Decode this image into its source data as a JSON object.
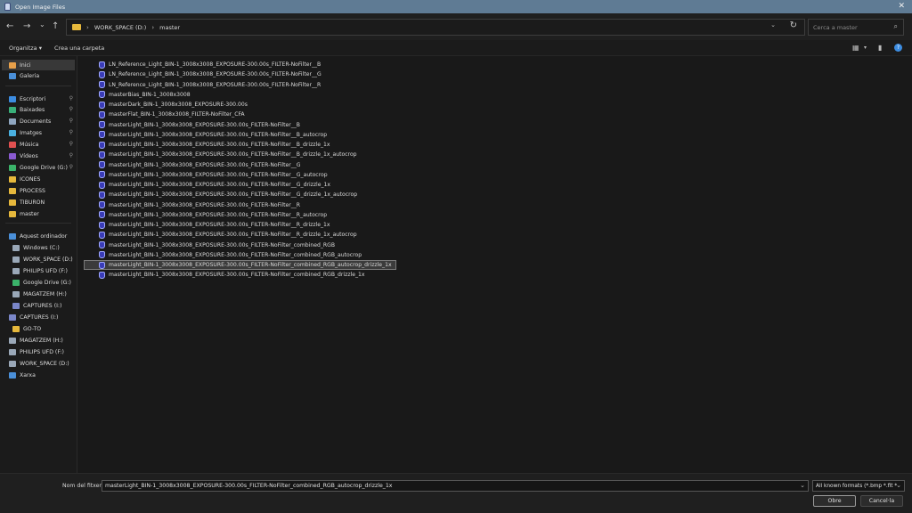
{
  "window": {
    "title": "Open Image Files"
  },
  "nav": {
    "back": "←",
    "forward": "→",
    "recent": "⌄",
    "up": "↑"
  },
  "address": {
    "root_sep": "›",
    "drive": "WORK_SPACE (D:)",
    "folder": "master"
  },
  "search": {
    "placeholder": "Cerca a master"
  },
  "toolbar": {
    "organize": "Organitza ▾",
    "new_folder": "Crea una carpeta"
  },
  "sidebar": {
    "items": [
      {
        "label": "Inici",
        "icon": "home-icon",
        "color": "#e8a04a"
      },
      {
        "label": "Galeria",
        "icon": "gallery-icon",
        "color": "#4a8fd8"
      },
      {
        "label": "Escriptori",
        "icon": "desktop-icon",
        "color": "#3c8ce0"
      },
      {
        "label": "Baixades",
        "icon": "download-icon",
        "color": "#39b07a"
      },
      {
        "label": "Documents",
        "icon": "documents-icon",
        "color": "#8fa6c0"
      },
      {
        "label": "Imatges",
        "icon": "pictures-icon",
        "color": "#4ab0e0"
      },
      {
        "label": "Música",
        "icon": "music-icon",
        "color": "#e05050"
      },
      {
        "label": "Vídeos",
        "icon": "videos-icon",
        "color": "#8a5ad0"
      },
      {
        "label": "Google Drive (G:)",
        "icon": "google-drive-icon",
        "color": "#3bb36a"
      },
      {
        "label": "ICONES",
        "icon": "folder-icon",
        "color": "#e6b83c"
      },
      {
        "label": "PROCESS",
        "icon": "folder-icon",
        "color": "#e6b83c"
      },
      {
        "label": "TIBURON",
        "icon": "folder-icon",
        "color": "#e6b83c"
      },
      {
        "label": "master",
        "icon": "folder-icon",
        "color": "#e6b83c"
      },
      {
        "label": "Aquest ordinador",
        "icon": "computer-icon",
        "color": "#4a8fd8"
      },
      {
        "label": "Windows (C:)",
        "icon": "drive-icon",
        "color": "#9aa8b8"
      },
      {
        "label": "WORK_SPACE (D:)",
        "icon": "drive-icon",
        "color": "#9aa8b8"
      },
      {
        "label": "PHILIPS UFD (F:)",
        "icon": "usb-drive-icon",
        "color": "#9aa8b8"
      },
      {
        "label": "Google Drive (G:)",
        "icon": "google-drive-icon",
        "color": "#3bb36a"
      },
      {
        "label": "MAGATZEM (H:)",
        "icon": "drive-icon",
        "color": "#9aa8b8"
      },
      {
        "label": "CAPTURES (I:)",
        "icon": "captures-drive-icon",
        "color": "#7a86c8"
      },
      {
        "label": "CAPTURES (I:)",
        "icon": "captures-drive-icon",
        "color": "#7a86c8"
      },
      {
        "label": "GO-TO",
        "icon": "folder-icon",
        "color": "#e6b83c"
      },
      {
        "label": "MAGATZEM (H:)",
        "icon": "drive-icon",
        "color": "#9aa8b8"
      },
      {
        "label": "PHILIPS UFD (F:)",
        "icon": "usb-drive-icon",
        "color": "#9aa8b8"
      },
      {
        "label": "WORK_SPACE (D:)",
        "icon": "drive-icon",
        "color": "#9aa8b8"
      },
      {
        "label": "Xarxa",
        "icon": "network-icon",
        "color": "#4a8fd8"
      }
    ]
  },
  "files": [
    "LN_Reference_Light_BIN-1_3008x3008_EXPOSURE-300.00s_FILTER-NoFilter__B",
    "LN_Reference_Light_BIN-1_3008x3008_EXPOSURE-300.00s_FILTER-NoFilter__G",
    "LN_Reference_Light_BIN-1_3008x3008_EXPOSURE-300.00s_FILTER-NoFilter__R",
    "masterBias_BIN-1_3008x3008",
    "masterDark_BIN-1_3008x3008_EXPOSURE-300.00s",
    "masterFlat_BIN-1_3008x3008_FILTER-NoFilter_CFA",
    "masterLight_BIN-1_3008x3008_EXPOSURE-300.00s_FILTER-NoFilter__B",
    "masterLight_BIN-1_3008x3008_EXPOSURE-300.00s_FILTER-NoFilter__B_autocrop",
    "masterLight_BIN-1_3008x3008_EXPOSURE-300.00s_FILTER-NoFilter__B_drizzle_1x",
    "masterLight_BIN-1_3008x3008_EXPOSURE-300.00s_FILTER-NoFilter__B_drizzle_1x_autocrop",
    "masterLight_BIN-1_3008x3008_EXPOSURE-300.00s_FILTER-NoFilter__G",
    "masterLight_BIN-1_3008x3008_EXPOSURE-300.00s_FILTER-NoFilter__G_autocrop",
    "masterLight_BIN-1_3008x3008_EXPOSURE-300.00s_FILTER-NoFilter__G_drizzle_1x",
    "masterLight_BIN-1_3008x3008_EXPOSURE-300.00s_FILTER-NoFilter__G_drizzle_1x_autocrop",
    "masterLight_BIN-1_3008x3008_EXPOSURE-300.00s_FILTER-NoFilter__R",
    "masterLight_BIN-1_3008x3008_EXPOSURE-300.00s_FILTER-NoFilter__R_autocrop",
    "masterLight_BIN-1_3008x3008_EXPOSURE-300.00s_FILTER-NoFilter__R_drizzle_1x",
    "masterLight_BIN-1_3008x3008_EXPOSURE-300.00s_FILTER-NoFilter__R_drizzle_1x_autocrop",
    "masterLight_BIN-1_3008x3008_EXPOSURE-300.00s_FILTER-NoFilter_combined_RGB",
    "masterLight_BIN-1_3008x3008_EXPOSURE-300.00s_FILTER-NoFilter_combined_RGB_autocrop",
    "masterLight_BIN-1_3008x3008_EXPOSURE-300.00s_FILTER-NoFilter_combined_RGB_autocrop_drizzle_1x",
    "masterLight_BIN-1_3008x3008_EXPOSURE-300.00s_FILTER-NoFilter_combined_RGB_drizzle_1x"
  ],
  "selected_file_index": 20,
  "footer": {
    "filename_label": "Nom del fitxer:",
    "filename_value": "masterLight_BIN-1_3008x3008_EXPOSURE-300.00s_FILTER-NoFilter_combined_RGB_autocrop_drizzle_1x",
    "filetype_value": "All known formats (*.bmp *.fit *",
    "open_label": "Obre",
    "cancel_label": "Cancel·la"
  },
  "colors": {
    "title_bar": "#5f7b94",
    "background": "#191919",
    "folder": "#e6b83c",
    "file_icon": "#3a3cb8"
  }
}
